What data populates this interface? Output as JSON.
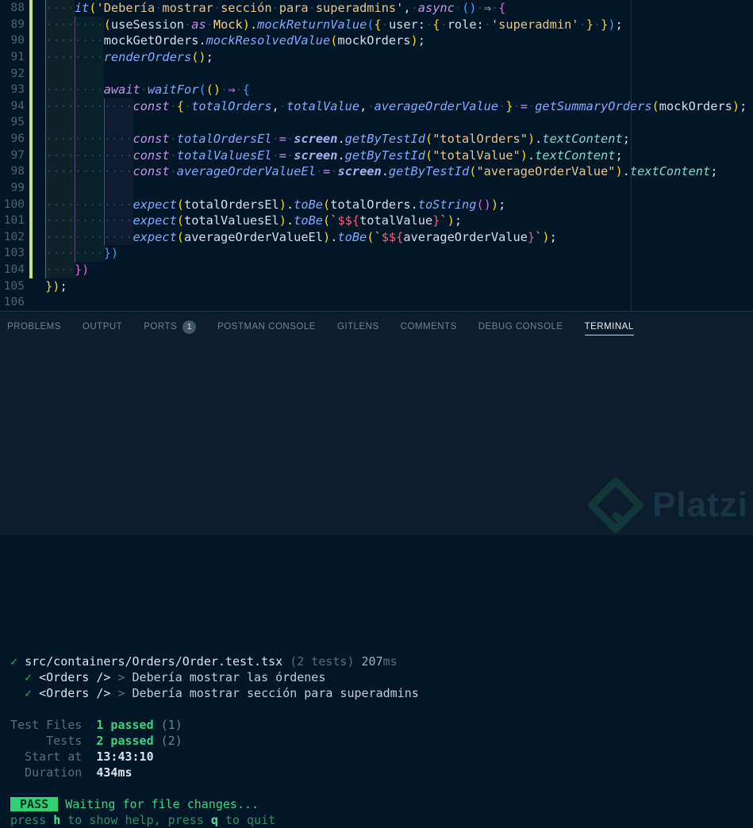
{
  "colors": {
    "editor_bg": "#011627",
    "panel_bg": "#0c1e2d",
    "keyword": "#c792ea",
    "function": "#82aaff",
    "string": "#ecc48d",
    "class": "#ffcb8b",
    "variable": "#d6deeb",
    "property": "#7fdbca",
    "bracket_gold": "#ffd700",
    "bracket_orchid": "#d670d6",
    "bracket_blue": "#3b9eff",
    "template_expr": "#ff5874",
    "line_number": "#4b6479",
    "git_added": "#c5e478",
    "pass_green": "#2fd172",
    "check_green": "#27b159"
  },
  "editor": {
    "lines": [
      {
        "num": "88",
        "git": true,
        "indent": 4,
        "tokens": [
          [
            "it",
            "fn"
          ],
          [
            "(",
            "b1"
          ],
          [
            "'Debería",
            "str"
          ],
          [
            "·",
            "ws"
          ],
          [
            "mostrar",
            "str"
          ],
          [
            "·",
            "ws"
          ],
          [
            "sección",
            "str"
          ],
          [
            "·",
            "ws"
          ],
          [
            "para",
            "str"
          ],
          [
            "·",
            "ws"
          ],
          [
            "superadmins'",
            "str"
          ],
          [
            ",",
            "pun"
          ],
          [
            "·",
            "ws"
          ],
          [
            "async",
            "kw"
          ],
          [
            "·",
            "ws"
          ],
          [
            "(",
            "b3"
          ],
          [
            ")",
            "b3"
          ],
          [
            "·",
            "ws"
          ],
          [
            "⇒",
            "op"
          ],
          [
            "·",
            "ws"
          ],
          [
            "{",
            "b2"
          ]
        ]
      },
      {
        "num": "89",
        "git": true,
        "indent": 8,
        "tokens": [
          [
            "(",
            "b1"
          ],
          [
            "useSession",
            "var"
          ],
          [
            "·",
            "ws"
          ],
          [
            "as",
            "kw"
          ],
          [
            "·",
            "ws"
          ],
          [
            "Mock",
            "cls"
          ],
          [
            ")",
            "b1"
          ],
          [
            ".",
            "pun"
          ],
          [
            "mockReturnValue",
            "fn"
          ],
          [
            "(",
            "b3"
          ],
          [
            "{",
            "b1"
          ],
          [
            "·",
            "ws"
          ],
          [
            "user:",
            "var"
          ],
          [
            "·",
            "ws"
          ],
          [
            "{",
            "b1"
          ],
          [
            "·",
            "ws"
          ],
          [
            "role:",
            "var"
          ],
          [
            "·",
            "ws"
          ],
          [
            "'superadmin'",
            "str"
          ],
          [
            "·",
            "ws"
          ],
          [
            "}",
            "b1"
          ],
          [
            "·",
            "ws"
          ],
          [
            "}",
            "b1"
          ],
          [
            ")",
            "b3"
          ],
          [
            ";",
            "pun"
          ]
        ]
      },
      {
        "num": "90",
        "git": true,
        "indent": 8,
        "tokens": [
          [
            "mockGetOrders",
            "var"
          ],
          [
            ".",
            "pun"
          ],
          [
            "mockResolvedValue",
            "fn"
          ],
          [
            "(",
            "b1"
          ],
          [
            "mockOrders",
            "var"
          ],
          [
            ")",
            "b1"
          ],
          [
            ";",
            "pun"
          ]
        ]
      },
      {
        "num": "91",
        "git": true,
        "indent": 8,
        "tokens": [
          [
            "renderOrders",
            "fn"
          ],
          [
            "(",
            "b1"
          ],
          [
            ")",
            "b1"
          ],
          [
            ";",
            "pun"
          ]
        ]
      },
      {
        "num": "92",
        "git": true,
        "indent": 8,
        "tokens": []
      },
      {
        "num": "93",
        "git": true,
        "indent": 8,
        "tokens": [
          [
            "await",
            "kw"
          ],
          [
            "·",
            "ws"
          ],
          [
            "waitFor",
            "fn"
          ],
          [
            "(",
            "b3"
          ],
          [
            "(",
            "b1"
          ],
          [
            ")",
            "b1"
          ],
          [
            "·",
            "ws"
          ],
          [
            "⇒",
            "op"
          ],
          [
            "·",
            "ws"
          ],
          [
            "{",
            "b3"
          ]
        ]
      },
      {
        "num": "94",
        "git": true,
        "indent": 12,
        "tokens": [
          [
            "const",
            "kw"
          ],
          [
            "·",
            "ws"
          ],
          [
            "{",
            "b1"
          ],
          [
            "·",
            "ws"
          ],
          [
            "totalOrders",
            "fn"
          ],
          [
            ",",
            "pun"
          ],
          [
            "·",
            "ws"
          ],
          [
            "totalValue",
            "fn"
          ],
          [
            ",",
            "pun"
          ],
          [
            "·",
            "ws"
          ],
          [
            "averageOrderValue",
            "fn"
          ],
          [
            "·",
            "ws"
          ],
          [
            "}",
            "b1"
          ],
          [
            "·",
            "ws"
          ],
          [
            "=",
            "op"
          ],
          [
            "·",
            "ws"
          ],
          [
            "getSummaryOrders",
            "fn"
          ],
          [
            "(",
            "b1"
          ],
          [
            "mockOrders",
            "var"
          ],
          [
            ")",
            "b1"
          ],
          [
            ";",
            "pun"
          ]
        ]
      },
      {
        "num": "95",
        "git": true,
        "indent": 12,
        "tokens": []
      },
      {
        "num": "96",
        "git": true,
        "indent": 12,
        "tokens": [
          [
            "const",
            "kw"
          ],
          [
            "·",
            "ws"
          ],
          [
            "totalOrdersEl",
            "fn"
          ],
          [
            "·",
            "ws"
          ],
          [
            "=",
            "op"
          ],
          [
            "·",
            "ws"
          ],
          [
            "screen",
            "scr"
          ],
          [
            ".",
            "pun"
          ],
          [
            "getByTestId",
            "fn"
          ],
          [
            "(",
            "b1"
          ],
          [
            "\"totalOrders\"",
            "str"
          ],
          [
            ")",
            "b1"
          ],
          [
            ".",
            "pun"
          ],
          [
            "textContent",
            "prop"
          ],
          [
            ";",
            "pun"
          ]
        ]
      },
      {
        "num": "97",
        "git": true,
        "indent": 12,
        "tokens": [
          [
            "const",
            "kw"
          ],
          [
            "·",
            "ws"
          ],
          [
            "totalValuesEl",
            "fn"
          ],
          [
            "·",
            "ws"
          ],
          [
            "=",
            "op"
          ],
          [
            "·",
            "ws"
          ],
          [
            "screen",
            "scr"
          ],
          [
            ".",
            "pun"
          ],
          [
            "getByTestId",
            "fn"
          ],
          [
            "(",
            "b1"
          ],
          [
            "\"totalValue\"",
            "str"
          ],
          [
            ")",
            "b1"
          ],
          [
            ".",
            "pun"
          ],
          [
            "textContent",
            "prop"
          ],
          [
            ";",
            "pun"
          ]
        ]
      },
      {
        "num": "98",
        "git": true,
        "indent": 12,
        "tokens": [
          [
            "const",
            "kw"
          ],
          [
            "·",
            "ws"
          ],
          [
            "averageOrderValueEl",
            "fn"
          ],
          [
            "·",
            "ws"
          ],
          [
            "=",
            "op"
          ],
          [
            "·",
            "ws"
          ],
          [
            "screen",
            "scr"
          ],
          [
            ".",
            "pun"
          ],
          [
            "getByTestId",
            "fn"
          ],
          [
            "(",
            "b1"
          ],
          [
            "\"averageOrderValue\"",
            "str"
          ],
          [
            ")",
            "b1"
          ],
          [
            ".",
            "pun"
          ],
          [
            "textContent",
            "prop"
          ],
          [
            ";",
            "pun"
          ]
        ]
      },
      {
        "num": "99",
        "git": true,
        "indent": 12,
        "tokens": []
      },
      {
        "num": "100",
        "git": true,
        "indent": 12,
        "tokens": [
          [
            "expect",
            "fn"
          ],
          [
            "(",
            "b1"
          ],
          [
            "totalOrdersEl",
            "var"
          ],
          [
            ")",
            "b1"
          ],
          [
            ".",
            "pun"
          ],
          [
            "toBe",
            "fn"
          ],
          [
            "(",
            "b1"
          ],
          [
            "totalOrders",
            "var"
          ],
          [
            ".",
            "pun"
          ],
          [
            "toString",
            "fn"
          ],
          [
            "(",
            "b2"
          ],
          [
            ")",
            "b2"
          ],
          [
            ")",
            "b1"
          ],
          [
            ";",
            "pun"
          ]
        ]
      },
      {
        "num": "101",
        "git": true,
        "indent": 12,
        "tokens": [
          [
            "expect",
            "fn"
          ],
          [
            "(",
            "b1"
          ],
          [
            "totalValuesEl",
            "var"
          ],
          [
            ")",
            "b1"
          ],
          [
            ".",
            "pun"
          ],
          [
            "toBe",
            "fn"
          ],
          [
            "(",
            "b1"
          ],
          [
            "`",
            "str"
          ],
          [
            "$${",
            "red"
          ],
          [
            "totalValue",
            "var"
          ],
          [
            "}",
            "red"
          ],
          [
            "`",
            "str"
          ],
          [
            ")",
            "b1"
          ],
          [
            ";",
            "pun"
          ]
        ]
      },
      {
        "num": "102",
        "git": true,
        "indent": 12,
        "tokens": [
          [
            "expect",
            "fn"
          ],
          [
            "(",
            "b1"
          ],
          [
            "averageOrderValueEl",
            "var"
          ],
          [
            ")",
            "b1"
          ],
          [
            ".",
            "pun"
          ],
          [
            "toBe",
            "fn"
          ],
          [
            "(",
            "b1"
          ],
          [
            "`",
            "str"
          ],
          [
            "$${",
            "red"
          ],
          [
            "averageOrderValue",
            "var"
          ],
          [
            "}",
            "red"
          ],
          [
            "`",
            "str"
          ],
          [
            ")",
            "b1"
          ],
          [
            ";",
            "pun"
          ]
        ]
      },
      {
        "num": "103",
        "git": true,
        "indent": 8,
        "tokens": [
          [
            "}",
            "b3"
          ],
          [
            ")",
            "b3"
          ]
        ]
      },
      {
        "num": "104",
        "git": true,
        "indent": 4,
        "tokens": [
          [
            "}",
            "b2"
          ],
          [
            ")",
            "b2"
          ]
        ]
      },
      {
        "num": "105",
        "git": false,
        "indent": 0,
        "tokens": [
          [
            "}",
            "b1"
          ],
          [
            ")",
            "b1"
          ],
          [
            ";",
            "pun"
          ]
        ]
      },
      {
        "num": "106",
        "git": false,
        "indent": 0,
        "tokens": []
      }
    ]
  },
  "panel": {
    "tabs": [
      {
        "label": "PROBLEMS"
      },
      {
        "label": "OUTPUT"
      },
      {
        "label": "PORTS",
        "badge": "1"
      },
      {
        "label": "POSTMAN CONSOLE"
      },
      {
        "label": "GITLENS"
      },
      {
        "label": "COMMENTS"
      },
      {
        "label": "DEBUG CONSOLE"
      },
      {
        "label": "TERMINAL",
        "active": true
      }
    ]
  },
  "terminal": {
    "lines": [
      {
        "segs": [
          [
            "✓ ",
            "grn"
          ],
          [
            "src/containers/Orders/Order.test.tsx ",
            "wht"
          ],
          [
            "(2 tests) ",
            "dim"
          ],
          [
            "207",
            "num"
          ],
          [
            "ms",
            "dim"
          ]
        ]
      },
      {
        "segs": [
          [
            "  ✓ ",
            "grn"
          ],
          [
            "<Orders />",
            "wht"
          ],
          [
            " > ",
            "dim"
          ],
          [
            "Debería mostrar las órdenes",
            "lt"
          ]
        ]
      },
      {
        "segs": [
          [
            "  ✓ ",
            "grn"
          ],
          [
            "<Orders />",
            "wht"
          ],
          [
            " > ",
            "dim"
          ],
          [
            "Debería mostrar sección para superadmins",
            "lt"
          ]
        ]
      },
      {
        "segs": []
      },
      {
        "segs": [
          [
            "Test Files  ",
            "dim"
          ],
          [
            "1 passed",
            "grnb"
          ],
          [
            " (1)",
            "dim2"
          ]
        ]
      },
      {
        "segs": [
          [
            "     Tests  ",
            "dim"
          ],
          [
            "2 passed",
            "grnb"
          ],
          [
            " (2)",
            "dim2"
          ]
        ]
      },
      {
        "segs": [
          [
            "  Start at  ",
            "dim"
          ],
          [
            "13:43:10",
            "whtb"
          ]
        ]
      },
      {
        "segs": [
          [
            "  Duration  ",
            "dim"
          ],
          [
            "434ms",
            "whtb"
          ]
        ]
      },
      {
        "segs": []
      },
      {
        "segs": [
          [
            " PASS ",
            "badge"
          ],
          [
            " ",
            "dim"
          ],
          [
            "Waiting for file changes...",
            "grn2"
          ]
        ]
      },
      {
        "segs": [
          [
            "press ",
            "dimg"
          ],
          [
            "h",
            "grn2b"
          ],
          [
            " to show help, press ",
            "dimg"
          ],
          [
            "q",
            "grn2b"
          ],
          [
            " to quit",
            "dimg"
          ]
        ]
      }
    ]
  },
  "watermark": {
    "text": "Platzi"
  }
}
